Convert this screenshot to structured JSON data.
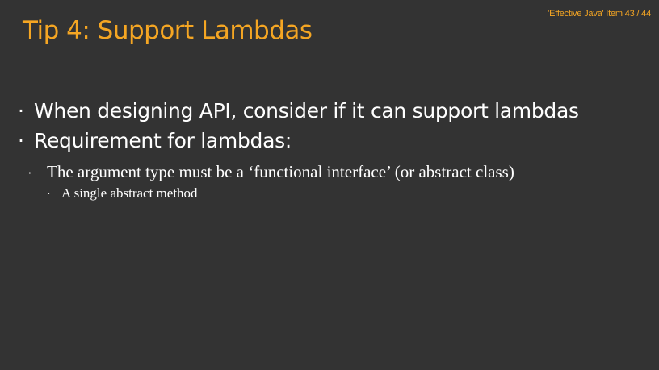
{
  "slide": {
    "reference": "'Effective Java' Item 43 / 44",
    "title": "Tip 4: Support Lambdas",
    "bullet_glyph": "·",
    "bullets": [
      {
        "text": "When designing API, consider if it can support lambdas"
      },
      {
        "text": "Requirement for lambdas:"
      },
      {
        "text": "The argument type must be a ‘functional interface’ (or abstract class)"
      },
      {
        "text": "A single abstract method"
      }
    ]
  },
  "colors": {
    "background": "#333333",
    "accent": "#F5A623",
    "body_text": "#FFFFFF"
  }
}
